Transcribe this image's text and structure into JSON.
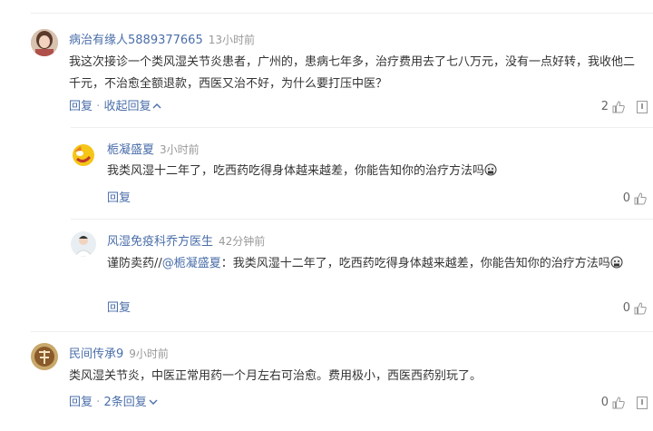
{
  "comments": [
    {
      "user": "病治有缘人5889377665",
      "time": "13小时前",
      "text": "我这次接诊一个类风湿关节炎患者，广州的，患病七年多，治疗费用去了七八万元，没有一点好转，我收他二千元，不治愈全额退款，西医又治不好，为什么要打压中医？",
      "reply_label": "回复",
      "collapse_label": "收起回复",
      "likes": "2",
      "replies": [
        {
          "user": "栀凝盛夏",
          "time": "3小时前",
          "text": "我类风湿十二年了，吃西药吃得身体越来越差，你能告知你的治疗方法吗",
          "reply_label": "回复",
          "likes": "0"
        },
        {
          "user": "风湿免疫科乔方医生",
          "time": "42分钟前",
          "text_prefix": "谨防卖药//",
          "text_at": "@栀凝盛夏",
          "text_body": "：我类风湿十二年了，吃西药吃得身体越来越差，你能告知你的治疗方法吗",
          "reply_label": "回复",
          "likes": "0"
        }
      ]
    },
    {
      "user": "民间传承9",
      "time": "9小时前",
      "text": "类风湿关节炎，中医正常用药一个月左右可治愈。费用极小，西医西药别玩了。",
      "reply_label": "回复",
      "replies_count_label": "2条回复",
      "likes": "0"
    }
  ]
}
